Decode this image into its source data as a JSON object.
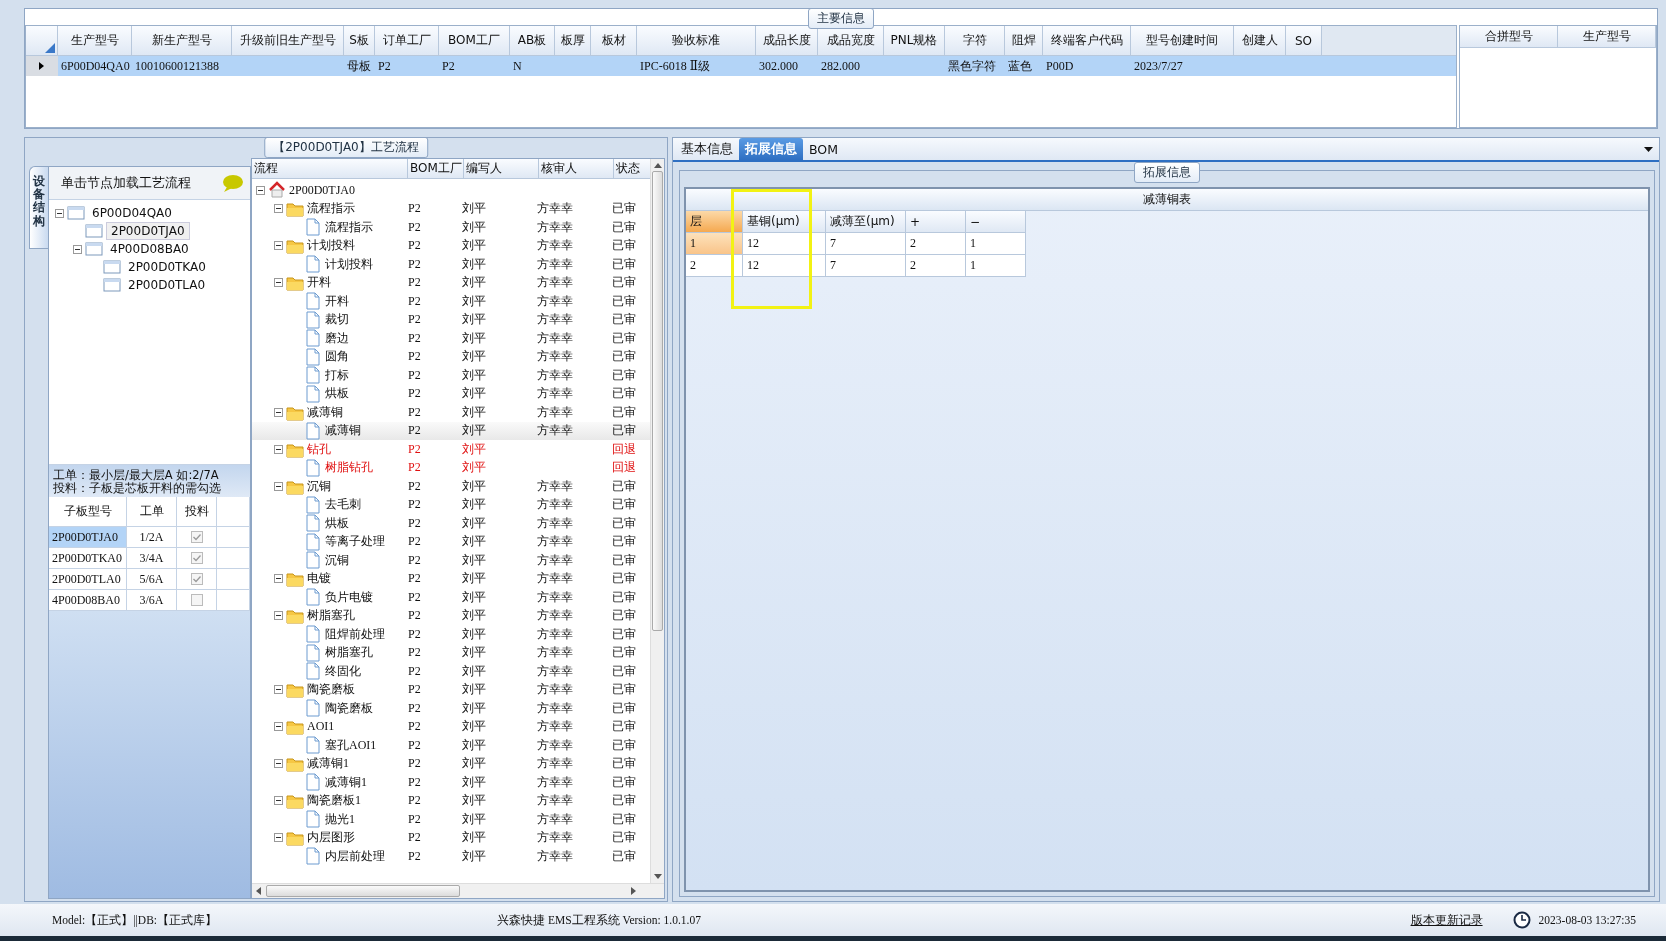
{
  "main_info": {
    "title": "主要信息",
    "columns": [
      "生产型号",
      "新生产型号",
      "升级前旧生产型号",
      "S板",
      "订单工厂",
      "BOM工厂",
      "AB板",
      "板厚",
      "板材",
      "验收标准",
      "成品长度",
      "成品宽度",
      "PNL规格",
      "字符",
      "阻焊",
      "终端客户代码",
      "型号创建时间",
      "创建人",
      "SO"
    ],
    "rows": [
      {
        "selected": true,
        "cells": [
          "6P00D04QA0",
          "10010600121388",
          null,
          "母板",
          "P2",
          "P2",
          "N",
          null,
          null,
          "IPC-6018 Ⅱ级",
          "302.000",
          "282.000",
          null,
          "黑色字符",
          "蓝色",
          "P00D",
          "2023/7/27",
          null,
          null
        ]
      }
    ]
  },
  "merge_grid": {
    "columns": [
      "合拼型号",
      "生产型号"
    ]
  },
  "structure_panel": {
    "side_tab": "设备结构",
    "header": "单击节点加载工艺流程",
    "tree": [
      {
        "label": "6P00D04QA0",
        "expanded": true,
        "selected": false,
        "children": [
          {
            "label": "2P00D0TJA0",
            "selected": true
          },
          {
            "label": "4P00D08BA0",
            "expanded": true,
            "selected": false,
            "children": [
              {
                "label": "2P00D0TKA0",
                "selected": false
              },
              {
                "label": "2P00D0TLA0",
                "selected": false
              }
            ]
          }
        ]
      }
    ],
    "note": [
      "工单：最小层/最大层A 如:2/7A",
      "投料：子板是芯板开料的需勾选"
    ],
    "table": {
      "columns": [
        "子板型号",
        "工单",
        "投料"
      ],
      "rows": [
        {
          "cells": [
            "2P00D0TJA0",
            "1/2A"
          ],
          "checked": true,
          "selected": true
        },
        {
          "cells": [
            "2P00D0TKA0",
            "3/4A"
          ],
          "checked": true,
          "selected": false
        },
        {
          "cells": [
            "2P00D0TLA0",
            "5/6A"
          ],
          "checked": true,
          "selected": false
        },
        {
          "cells": [
            "4P00D08BA0",
            "3/6A"
          ],
          "checked": false,
          "selected": false
        }
      ]
    }
  },
  "flow": {
    "title": "【2P00D0TJA0】工艺流程",
    "columns": [
      "流程",
      "BOM工厂",
      "编写人",
      "核审人",
      "状态"
    ],
    "tree": [
      {
        "kind": "root",
        "label": "2P00D0TJA0",
        "expanded": true,
        "selected": false,
        "children": [
          {
            "kind": "folder",
            "label": "流程指示",
            "bom": "P2",
            "writer": "刘平",
            "reviewer": "方幸幸",
            "status": "已审",
            "rejected": false,
            "selected": false,
            "expanded": true,
            "children": [
              {
                "kind": "file",
                "label": "流程指示",
                "bom": "P2",
                "writer": "刘平",
                "reviewer": "方幸幸",
                "status": "已审",
                "rejected": false,
                "selected": false
              }
            ]
          },
          {
            "kind": "folder",
            "label": "计划投料",
            "bom": "P2",
            "writer": "刘平",
            "reviewer": "方幸幸",
            "status": "已审",
            "rejected": false,
            "selected": false,
            "expanded": true,
            "children": [
              {
                "kind": "file",
                "label": "计划投料",
                "bom": "P2",
                "writer": "刘平",
                "reviewer": "方幸幸",
                "status": "已审",
                "rejected": false,
                "selected": false
              }
            ]
          },
          {
            "kind": "folder",
            "label": "开料",
            "bom": "P2",
            "writer": "刘平",
            "reviewer": "方幸幸",
            "status": "已审",
            "rejected": false,
            "selected": false,
            "expanded": true,
            "children": [
              {
                "kind": "file",
                "label": "开料",
                "bom": "P2",
                "writer": "刘平",
                "reviewer": "方幸幸",
                "status": "已审",
                "rejected": false,
                "selected": false
              },
              {
                "kind": "file",
                "label": "裁切",
                "bom": "P2",
                "writer": "刘平",
                "reviewer": "方幸幸",
                "status": "已审",
                "rejected": false,
                "selected": false
              },
              {
                "kind": "file",
                "label": "磨边",
                "bom": "P2",
                "writer": "刘平",
                "reviewer": "方幸幸",
                "status": "已审",
                "rejected": false,
                "selected": false
              },
              {
                "kind": "file",
                "label": "圆角",
                "bom": "P2",
                "writer": "刘平",
                "reviewer": "方幸幸",
                "status": "已审",
                "rejected": false,
                "selected": false
              },
              {
                "kind": "file",
                "label": "打标",
                "bom": "P2",
                "writer": "刘平",
                "reviewer": "方幸幸",
                "status": "已审",
                "rejected": false,
                "selected": false
              },
              {
                "kind": "file",
                "label": "烘板",
                "bom": "P2",
                "writer": "刘平",
                "reviewer": "方幸幸",
                "status": "已审",
                "rejected": false,
                "selected": false
              }
            ]
          },
          {
            "kind": "folder",
            "label": "减薄铜",
            "bom": "P2",
            "writer": "刘平",
            "reviewer": "方幸幸",
            "status": "已审",
            "rejected": false,
            "selected": false,
            "expanded": true,
            "children": [
              {
                "kind": "file",
                "label": "减薄铜",
                "bom": "P2",
                "writer": "刘平",
                "reviewer": "方幸幸",
                "status": "已审",
                "rejected": false,
                "selected": true
              }
            ]
          },
          {
            "kind": "folder",
            "label": "钻孔",
            "bom": "P2",
            "writer": "刘平",
            "status": "回退",
            "rejected": true,
            "selected": false,
            "expanded": true,
            "children": [
              {
                "kind": "file",
                "label": "树脂钻孔",
                "bom": "P2",
                "writer": "刘平",
                "status": "回退",
                "rejected": true,
                "selected": false
              }
            ]
          },
          {
            "kind": "folder",
            "label": "沉铜",
            "bom": "P2",
            "writer": "刘平",
            "reviewer": "方幸幸",
            "status": "已审",
            "rejected": false,
            "selected": false,
            "expanded": true,
            "children": [
              {
                "kind": "file",
                "label": "去毛刺",
                "bom": "P2",
                "writer": "刘平",
                "reviewer": "方幸幸",
                "status": "已审",
                "rejected": false,
                "selected": false
              },
              {
                "kind": "file",
                "label": "烘板",
                "bom": "P2",
                "writer": "刘平",
                "reviewer": "方幸幸",
                "status": "已审",
                "rejected": false,
                "selected": false
              },
              {
                "kind": "file",
                "label": "等离子处理",
                "bom": "P2",
                "writer": "刘平",
                "reviewer": "方幸幸",
                "status": "已审",
                "rejected": false,
                "selected": false
              },
              {
                "kind": "file",
                "label": "沉铜",
                "bom": "P2",
                "writer": "刘平",
                "reviewer": "方幸幸",
                "status": "已审",
                "rejected": false,
                "selected": false
              }
            ]
          },
          {
            "kind": "folder",
            "label": "电镀",
            "bom": "P2",
            "writer": "刘平",
            "reviewer": "方幸幸",
            "status": "已审",
            "rejected": false,
            "selected": false,
            "expanded": true,
            "children": [
              {
                "kind": "file",
                "label": "负片电镀",
                "bom": "P2",
                "writer": "刘平",
                "reviewer": "方幸幸",
                "status": "已审",
                "rejected": false,
                "selected": false
              }
            ]
          },
          {
            "kind": "folder",
            "label": "树脂塞孔",
            "bom": "P2",
            "writer": "刘平",
            "reviewer": "方幸幸",
            "status": "已审",
            "rejected": false,
            "selected": false,
            "expanded": true,
            "children": [
              {
                "kind": "file",
                "label": "阻焊前处理",
                "bom": "P2",
                "writer": "刘平",
                "reviewer": "方幸幸",
                "status": "已审",
                "rejected": false,
                "selected": false
              },
              {
                "kind": "file",
                "label": "树脂塞孔",
                "bom": "P2",
                "writer": "刘平",
                "reviewer": "方幸幸",
                "status": "已审",
                "rejected": false,
                "selected": false
              },
              {
                "kind": "file",
                "label": "终固化",
                "bom": "P2",
                "writer": "刘平",
                "reviewer": "方幸幸",
                "status": "已审",
                "rejected": false,
                "selected": false
              }
            ]
          },
          {
            "kind": "folder",
            "label": "陶瓷磨板",
            "bom": "P2",
            "writer": "刘平",
            "reviewer": "方幸幸",
            "status": "已审",
            "rejected": false,
            "selected": false,
            "expanded": true,
            "children": [
              {
                "kind": "file",
                "label": "陶瓷磨板",
                "bom": "P2",
                "writer": "刘平",
                "reviewer": "方幸幸",
                "status": "已审",
                "rejected": false,
                "selected": false
              }
            ]
          },
          {
            "kind": "folder",
            "label": "AOI1",
            "bom": "P2",
            "writer": "刘平",
            "reviewer": "方幸幸",
            "status": "已审",
            "rejected": false,
            "selected": false,
            "expanded": true,
            "children": [
              {
                "kind": "file",
                "label": "塞孔AOI1",
                "bom": "P2",
                "writer": "刘平",
                "reviewer": "方幸幸",
                "status": "已审",
                "rejected": false,
                "selected": false
              }
            ]
          },
          {
            "kind": "folder",
            "label": "减薄铜1",
            "bom": "P2",
            "writer": "刘平",
            "reviewer": "方幸幸",
            "status": "已审",
            "rejected": false,
            "selected": false,
            "expanded": true,
            "children": [
              {
                "kind": "file",
                "label": "减薄铜1",
                "bom": "P2",
                "writer": "刘平",
                "reviewer": "方幸幸",
                "status": "已审",
                "rejected": false,
                "selected": false
              }
            ]
          },
          {
            "kind": "folder",
            "label": "陶瓷磨板1",
            "bom": "P2",
            "writer": "刘平",
            "reviewer": "方幸幸",
            "status": "已审",
            "rejected": false,
            "selected": false,
            "expanded": true,
            "children": [
              {
                "kind": "file",
                "label": "抛光1",
                "bom": "P2",
                "writer": "刘平",
                "reviewer": "方幸幸",
                "status": "已审",
                "rejected": false,
                "selected": false
              }
            ]
          },
          {
            "kind": "folder",
            "label": "内层图形",
            "bom": "P2",
            "writer": "刘平",
            "reviewer": "方幸幸",
            "status": "已审",
            "rejected": false,
            "selected": false,
            "expanded": true,
            "children": [
              {
                "kind": "file",
                "label": "内层前处理",
                "bom": "P2",
                "writer": "刘平",
                "reviewer": "方幸幸",
                "status": "已审",
                "rejected": false,
                "selected": false
              }
            ]
          }
        ]
      }
    ]
  },
  "detail": {
    "tabs": [
      {
        "label": "基本信息",
        "selected": false
      },
      {
        "label": "拓展信息",
        "selected": true
      },
      {
        "label": "BOM",
        "selected": false
      }
    ],
    "group_title": "拓展信息",
    "table_title": "减薄铜表",
    "columns": [
      {
        "label": "层",
        "current": true,
        "highlighted": false
      },
      {
        "label": "基铜(μm)",
        "current": false,
        "highlighted": true
      },
      {
        "label": "减薄至(μm)",
        "current": false,
        "highlighted": false
      },
      {
        "label": "+",
        "current": false,
        "highlighted": false
      },
      {
        "label": "−",
        "current": false,
        "highlighted": false
      }
    ],
    "rows": [
      {
        "selected": true,
        "cells": [
          "1",
          "12",
          "7",
          "2",
          "1"
        ]
      },
      {
        "selected": false,
        "cells": [
          "2",
          "12",
          "7",
          "2",
          "1"
        ]
      }
    ]
  },
  "status_bar": {
    "mode": "Model:【正式】||DB:【正式库】",
    "product": "兴森快捷 EMS工程系统 Version: 1.0.1.07",
    "link": "版本更新记录",
    "datetime": "2023-08-03 13:27:35"
  }
}
